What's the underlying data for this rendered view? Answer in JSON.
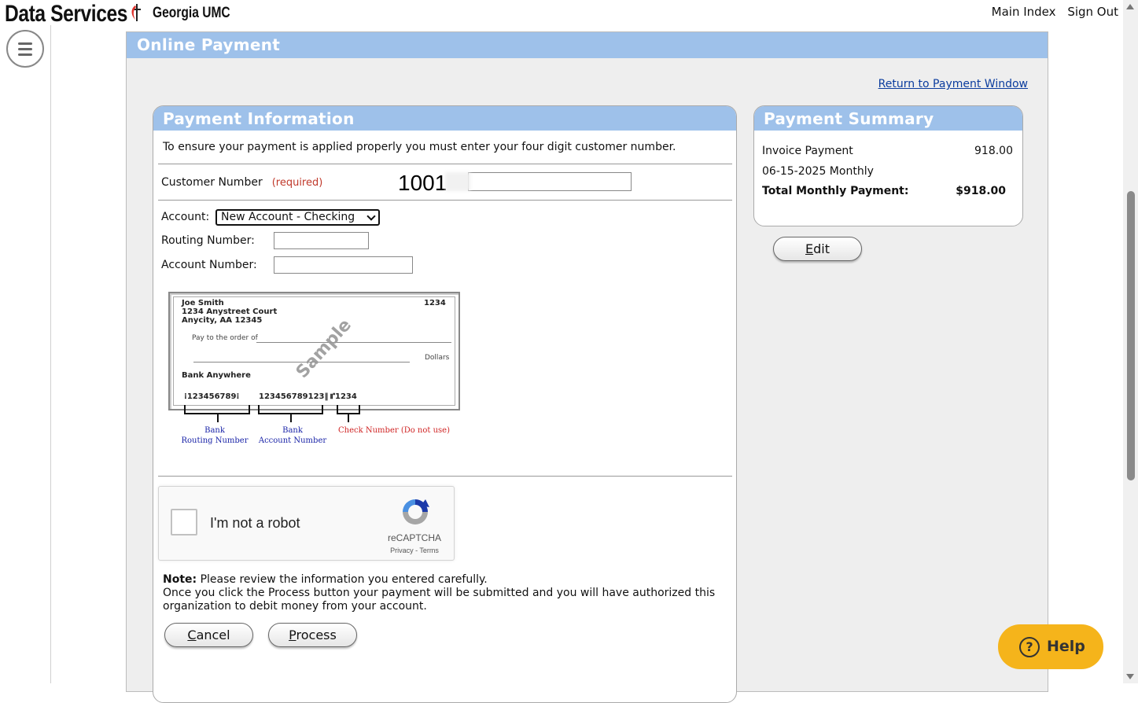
{
  "header": {
    "brand": "Data Services",
    "org": "Georgia UMC",
    "links": {
      "main_index": "Main Index",
      "sign_out": "Sign Out"
    }
  },
  "colors": {
    "header_blue": "#9ec1ea",
    "link_blue": "#0b3c9e",
    "required_red": "#c0392b",
    "help_yellow": "#f5b41b"
  },
  "page": {
    "title": "Online Payment",
    "return_link": "Return to Payment Window"
  },
  "payment_info": {
    "title": "Payment Information",
    "intro": "To ensure your payment is applied properly you must enter your four digit customer number.",
    "customer_number_label": "Customer Number",
    "required_label": "(required)",
    "customer_number_value": "1001",
    "account_label": "Account:",
    "account_selected": "New Account - Checking",
    "routing_label": "Routing Number:",
    "routing_value": "",
    "account_number_label": "Account Number:",
    "account_number_value": ""
  },
  "sample_check": {
    "name": "Joe Smith",
    "address1": "1234 Anystreet Court",
    "address2": "Anycity, AA 12345",
    "check_no": "1234",
    "pay_to": "Pay to the order of",
    "dollars": "Dollars",
    "bank": "Bank Anywhere",
    "micr_routing": "123456789",
    "micr_account": "123456789123",
    "micr_check": "1234",
    "watermark": "Sample",
    "label_routing_1": "Bank",
    "label_routing_2": "Routing Number",
    "label_account_1": "Bank",
    "label_account_2": "Account Number",
    "label_check": "Check Number (Do not use)"
  },
  "captcha": {
    "label": "I'm not a robot",
    "brand": "reCAPTCHA",
    "links": "Privacy - Terms",
    "checked": false
  },
  "note": {
    "bold": "Note:",
    "line1": "Please review the information you entered carefully.",
    "line2": "Once you click the Process button your payment will be submitted and you will have authorized this organization to debit money from your account."
  },
  "buttons": {
    "cancel": "Cancel",
    "process": "Process",
    "edit": "Edit"
  },
  "summary": {
    "title": "Payment Summary",
    "rows": [
      {
        "label": "Invoice Payment",
        "value": "918.00"
      },
      {
        "label": "06-15-2025 Monthly",
        "value": ""
      }
    ],
    "total_label": "Total Monthly Payment:",
    "total_value": "$918.00"
  },
  "help": {
    "label": "Help",
    "icon": "question-circle-icon"
  }
}
